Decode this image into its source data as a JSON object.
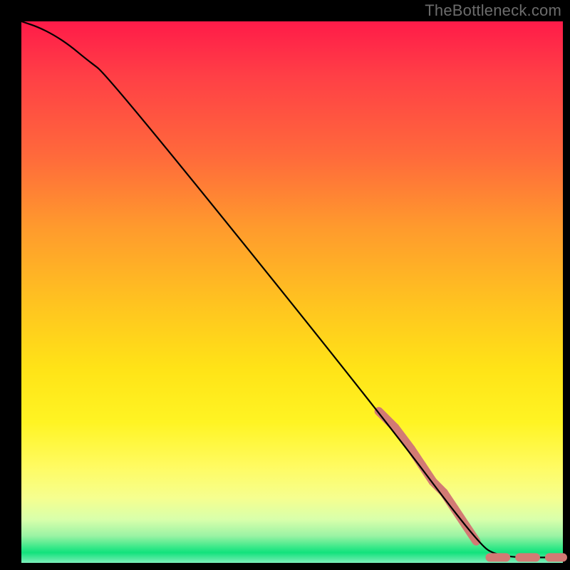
{
  "watermark": "TheBottleneck.com",
  "chart_data": {
    "type": "line",
    "title": "",
    "xlabel": "",
    "ylabel": "",
    "xlim": [
      0,
      100
    ],
    "ylim": [
      0,
      100
    ],
    "grid": false,
    "legend": false,
    "series": [
      {
        "name": "curve",
        "stroke": "#000000",
        "x": [
          0,
          3,
          6,
          9,
          12,
          16,
          66,
          84,
          88,
          100
        ],
        "y": [
          100,
          99,
          97.5,
          95.5,
          93,
          90,
          28,
          4,
          1,
          1
        ]
      },
      {
        "name": "thick-diagonal-segment",
        "stroke": "#d27a74",
        "stroke_width_px": 12,
        "x": [
          66,
          69,
          72,
          74,
          76,
          78,
          80,
          82,
          84
        ],
        "y": [
          28,
          25,
          21,
          18,
          15,
          13,
          10,
          7,
          4
        ]
      },
      {
        "name": "bottom-dashes",
        "stroke": "#d27a74",
        "stroke_width_px": 12,
        "dashes": [
          {
            "x": [
              86.5,
              89.5
            ],
            "y": [
              1,
              1
            ]
          },
          {
            "x": [
              92.0,
              95.0
            ],
            "y": [
              1,
              1
            ]
          },
          {
            "x": [
              97.5,
              100
            ],
            "y": [
              1,
              1
            ]
          }
        ]
      }
    ],
    "gradient_stops": [
      {
        "pos": 0.0,
        "color": "#ff1b49"
      },
      {
        "pos": 0.25,
        "color": "#ff6a3b"
      },
      {
        "pos": 0.52,
        "color": "#ffc320"
      },
      {
        "pos": 0.74,
        "color": "#fff423"
      },
      {
        "pos": 0.92,
        "color": "#d8ffab"
      },
      {
        "pos": 0.97,
        "color": "#36e888"
      },
      {
        "pos": 1.0,
        "color": "#7df0bd"
      }
    ]
  }
}
